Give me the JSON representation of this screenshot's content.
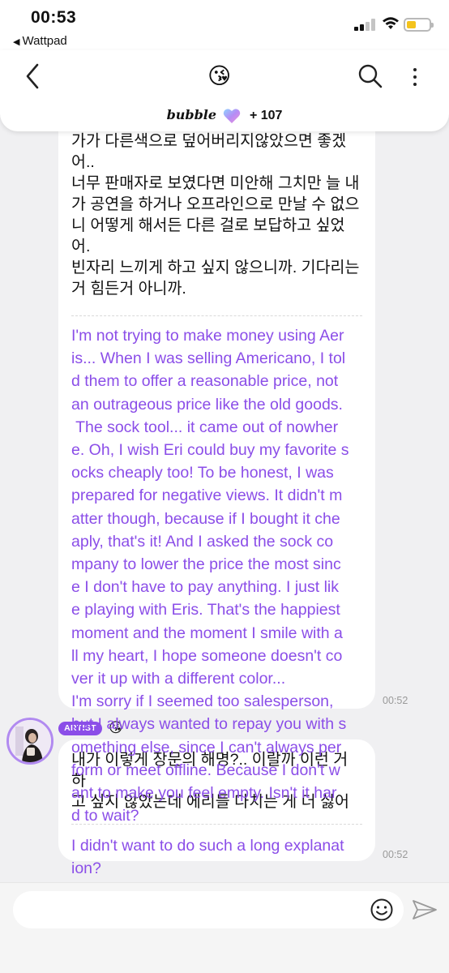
{
  "status_bar": {
    "time": "00:53",
    "back_app": "Wattpad"
  },
  "header": {
    "title_emoji": "😘",
    "brand": "bubble",
    "count": "+ 107",
    "accent_color": "#8b4ee8"
  },
  "messages": [
    {
      "korean": "가가 다른색으로 덮어버리지않았으면 좋겠어.. 너무 판매자로 보였다면 미안해 그치만 늘 내가 공연을 하거나 오프라인으로 만날 수 없으니 어떻게 해서든 다른 걸로 보답하고 싶었어. 빈자리 느끼게 하고 싶지 않으니까. 기다리는 거 힘든거 아니까.",
      "korean_lines": [
        "가가 다른색으로 덮어버리지않았으면 좋겠어..",
        "너무 판매자로 보였다면 미안해 그치만 늘 내",
        "가 공연을 하거나 오프라인으로 만날 수 없으",
        "니 어떻게 해서든 다른 걸로 보답하고 싶었어.",
        "빈자리 느끼게 하고 싶지 않으니까. 기다리는",
        "거 힘든거 아니까."
      ],
      "translation_lines": [
        "I'm not trying to make money using Aer",
        "is... When I was selling Americano, I tol",
        "d them to offer a reasonable price, not",
        "an outrageous price like the old goods.",
        " The sock tool... it came out of nowher",
        "e. Oh, I wish Eri could buy my favorite s",
        "ocks cheaply too! To be honest, I was",
        "prepared for negative views. It didn't m",
        "atter though, because if I bought it che",
        "aply, that's it! And I asked the sock co",
        "mpany to lower the price the most sinc",
        "e I don't have to pay anything. I just lik",
        "e playing with Eris. That's the happiest",
        "moment and the moment I smile with a",
        "ll my heart, I hope someone doesn't co",
        "ver it up with a different color...",
        "I'm sorry if I seemed too salesperson,",
        "but I always wanted to repay you with s",
        "omething else, since I can't always per",
        "form or meet offline. Because I don't w",
        "ant to make you feel empty. Isn't it har",
        "d to wait?"
      ],
      "time": "00:52"
    },
    {
      "sender_badge": "ARTIST",
      "sender_emoji": "😘",
      "korean_lines": [
        "내가 이렇게 장문의 해명?.. 이랄까 이런 거 하",
        "고 싶지 않았는데 에리들 다치는 게 더 싫어"
      ],
      "translation_lines": [
        "I didn't want to do such a long explanat",
        "ion?"
      ],
      "time": "00:52"
    }
  ],
  "input": {
    "placeholder": "",
    "value": ""
  }
}
